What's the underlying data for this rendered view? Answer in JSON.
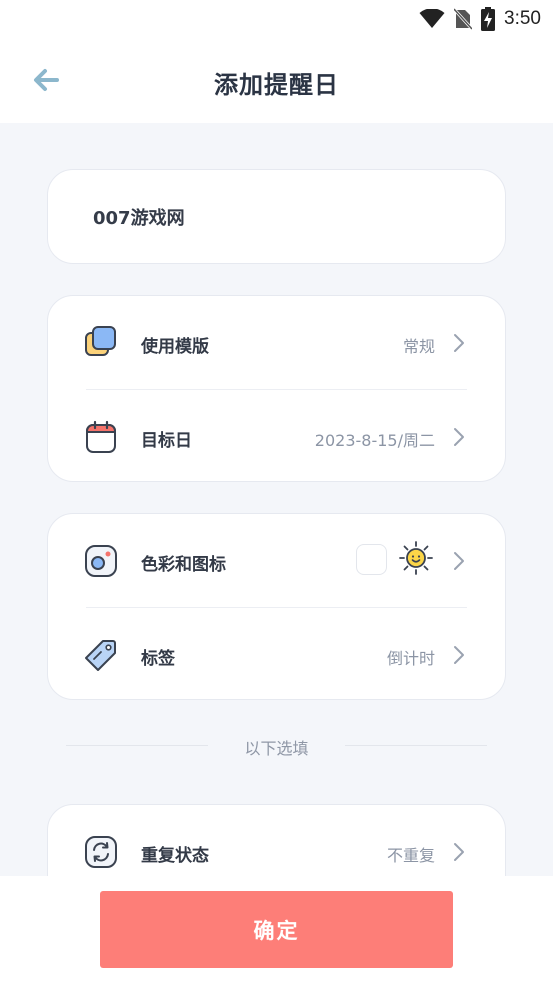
{
  "status_bar": {
    "time": "3:50"
  },
  "header": {
    "title": "添加提醒日"
  },
  "name_card": {
    "value": "007游戏网"
  },
  "section1": {
    "template": {
      "label": "使用模版",
      "value": "常规"
    },
    "target_date": {
      "label": "目标日",
      "value": "2023-8-15/周二"
    }
  },
  "section2": {
    "color_icon": {
      "label": "色彩和图标",
      "swatch_color": "#ffffff",
      "icon": "sun-icon"
    },
    "tag": {
      "label": "标签",
      "value": "倒计时"
    }
  },
  "optional": {
    "divider_text": "以下选填"
  },
  "section3": {
    "repeat": {
      "label": "重复状态",
      "value": "不重复"
    }
  },
  "footer": {
    "confirm_label": "确定"
  },
  "colors": {
    "accent": "#fd7e78",
    "back_arrow": "#8cb7cc",
    "text_primary": "#2b3444",
    "text_secondary": "#8c95a5",
    "background": "#f4f6fa"
  }
}
